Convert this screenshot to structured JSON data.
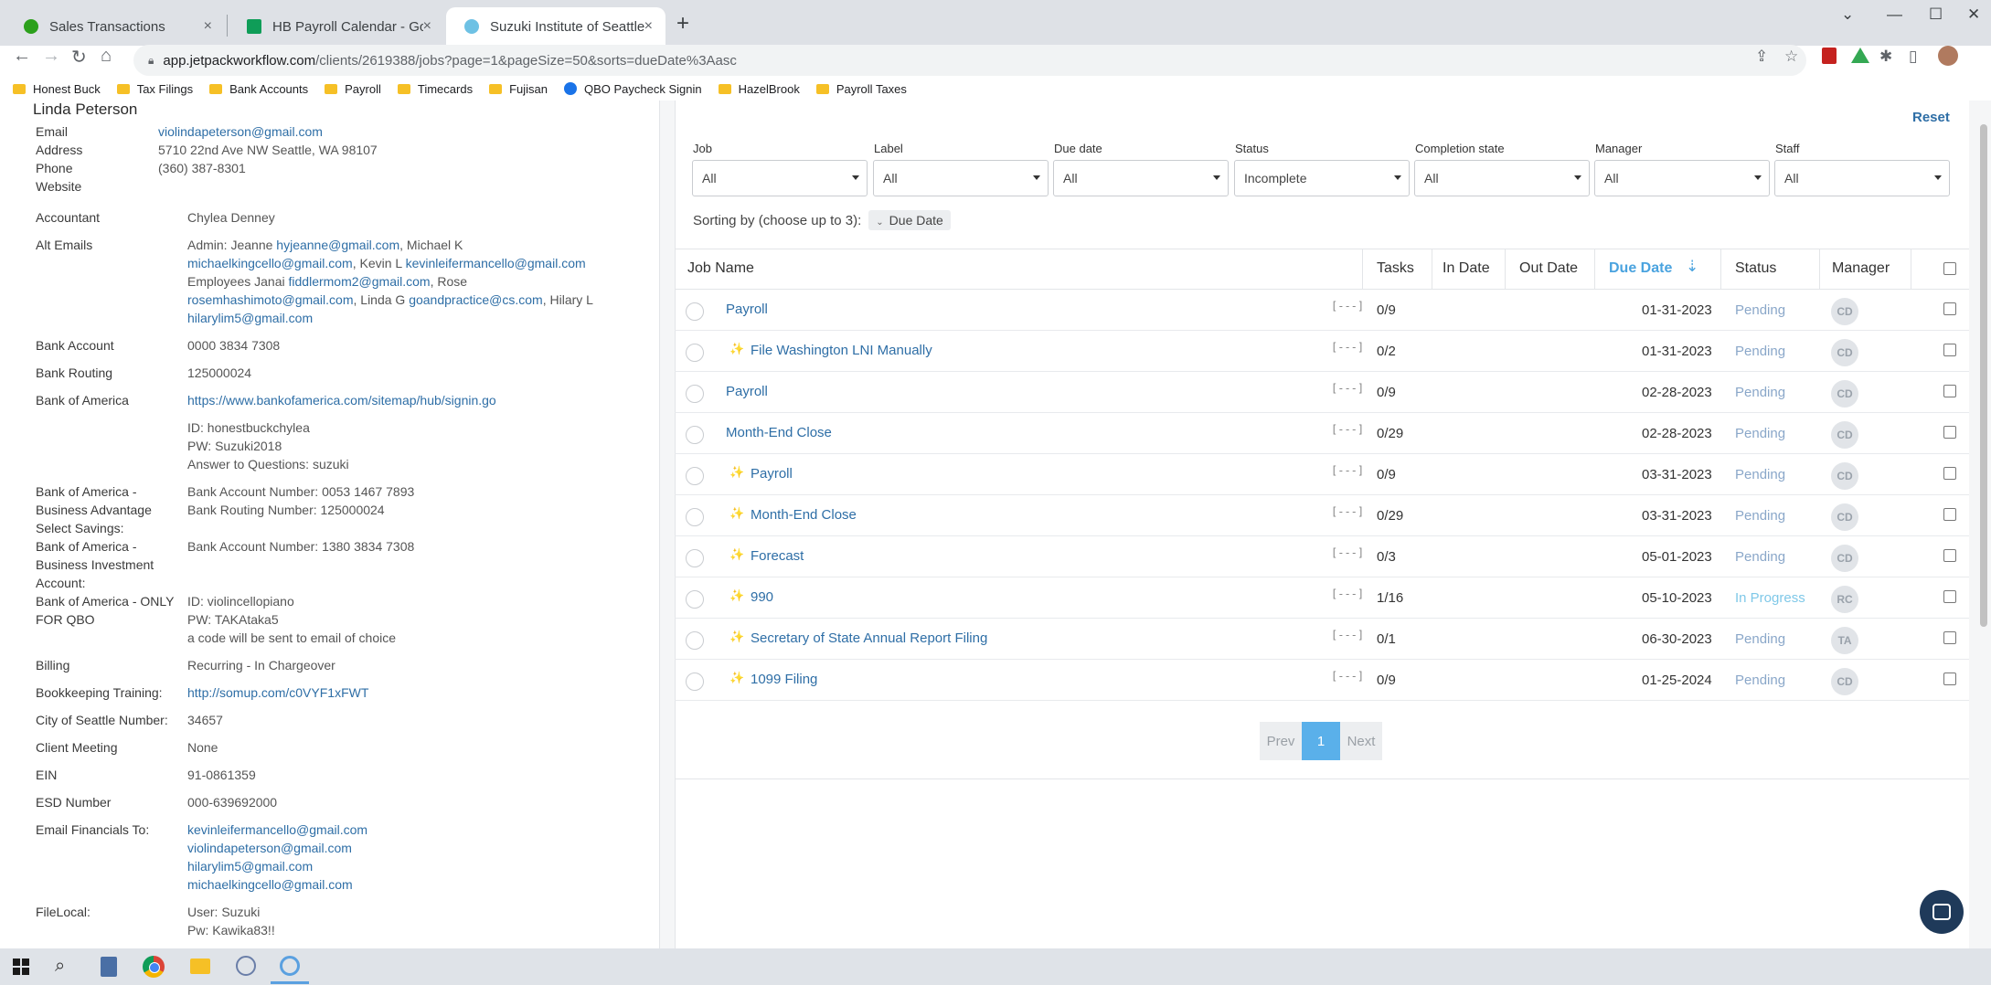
{
  "browser": {
    "tabs": [
      {
        "title": "Sales Transactions",
        "icon_color": "#2ca01c"
      },
      {
        "title": "HB Payroll Calendar - Google She",
        "icon_color": "#0f9d58"
      },
      {
        "title": "Suzuki Institute of Seattle - Jetpa",
        "icon_color": "#6ec1e4"
      }
    ],
    "new_tab": "+",
    "close_glyph": "×",
    "url_host": "app.jetpackworkflow.com",
    "url_path": "/clients/2619388/jobs?page=1&pageSize=50&sorts=dueDate%3Aasc",
    "bookmarks": [
      {
        "label": "Honest Buck",
        "icon": "folder-icon"
      },
      {
        "label": "Tax Filings",
        "icon": "folder-icon"
      },
      {
        "label": "Bank Accounts",
        "icon": "folder-icon"
      },
      {
        "label": "Payroll",
        "icon": "folder-icon"
      },
      {
        "label": "Timecards",
        "icon": "folder-icon"
      },
      {
        "label": "Fujisan",
        "icon": "folder-icon"
      },
      {
        "label": "QBO Paycheck Signin",
        "icon": "globe-icon"
      },
      {
        "label": "HazelBrook",
        "icon": "folder-icon"
      },
      {
        "label": "Payroll Taxes",
        "icon": "folder-icon"
      }
    ]
  },
  "client": {
    "name": "Linda Peterson",
    "contact": [
      {
        "label": "Email",
        "value": "violindapeterson@gmail.com",
        "link": true
      },
      {
        "label": "Address",
        "value": "5710 22nd Ave NW Seattle, WA 98107",
        "link": false
      },
      {
        "label": "Phone",
        "value": "(360) 387-8301",
        "link": false
      },
      {
        "label": "Website",
        "value": "",
        "link": false
      }
    ],
    "fields": {
      "accountant": {
        "label": "Accountant",
        "value": "Chylea Denney"
      },
      "alt_emails": {
        "label": "Alt Emails",
        "line1_a": "Admin: Jeanne ",
        "line1_b": "hyjeanne@gmail.com",
        "line1_c": ", Michael K",
        "line2_a": "michaelkingcello@gmail.com",
        "line2_b": ", Kevin L ",
        "line2_c": "kevinleifermancello@gmail.com",
        "line3_a": "Employees Janai ",
        "line3_b": "fiddlermom2@gmail.com",
        "line3_c": ", Rose",
        "line4_a": "rosemhashimoto@gmail.com",
        "line4_b": ", Linda G ",
        "line4_c": "goandpractice@cs.com",
        "line4_d": ", Hilary L",
        "line5_a": "hilarylim5@gmail.com"
      },
      "bank_account": {
        "label": "Bank Account",
        "value": "0000 3834 7308"
      },
      "bank_routing": {
        "label": "Bank Routing",
        "value": "125000024"
      },
      "boa": {
        "label": "Bank of America",
        "link": "https://www.bankofamerica.com/sitemap/hub/signin.go",
        "id": "ID: honestbuckchylea",
        "pw": "PW: Suzuki2018",
        "answer": "Answer to Questions: suzuki"
      },
      "boa_savings": {
        "label_1": "Bank of America -",
        "label_2": "Business Advantage",
        "label_3": "Select Savings:",
        "value_1": "Bank Account Number: 0053 1467 7893",
        "value_2": "Bank Routing Number: 125000024"
      },
      "boa_investment": {
        "label_1": "Bank of America -",
        "label_2": "Business Investment",
        "label_3": "Account:",
        "value_1": "Bank Account Number: 1380 3834 7308"
      },
      "boa_qbo": {
        "label_1": "Bank of America - ONLY",
        "label_2": "FOR QBO",
        "value_1": "ID: violincellopiano",
        "value_2": "PW: TAKAtaka5",
        "value_3": "a code will be sent to email of choice"
      },
      "billing": {
        "label": "Billing",
        "value": "Recurring - In Chargeover"
      },
      "bookkeeping": {
        "label": "Bookkeeping Training:",
        "value": "http://somup.com/c0VYF1xFWT"
      },
      "city_seattle": {
        "label": "City of Seattle Number:",
        "value": "34657"
      },
      "client_meeting": {
        "label": "Client Meeting",
        "value": "None"
      },
      "ein": {
        "label": "EIN",
        "value": "91-0861359"
      },
      "esd": {
        "label": "ESD Number",
        "value": "000-639692000"
      },
      "email_financials": {
        "label": "Email Financials To:",
        "emails": [
          "kevinleifermancello@gmail.com",
          "violindapeterson@gmail.com",
          "hilarylim5@gmail.com",
          "michaelkingcello@gmail.com"
        ]
      },
      "filelocal": {
        "label": "FileLocal:",
        "user": "User: Suzuki",
        "pw": "Pw: Kawika83!!"
      }
    }
  },
  "filters": {
    "reset": "Reset",
    "items": [
      {
        "label": "Job",
        "value": "All"
      },
      {
        "label": "Label",
        "value": "All"
      },
      {
        "label": "Due date",
        "value": "All"
      },
      {
        "label": "Status",
        "value": "Incomplete"
      },
      {
        "label": "Completion state",
        "value": "All"
      },
      {
        "label": "Manager",
        "value": "All"
      },
      {
        "label": "Staff",
        "value": "All"
      }
    ],
    "sorting_label": "Sorting by (choose up to 3):",
    "sort_chip": "Due Date"
  },
  "table": {
    "headers": {
      "job_name": "Job Name",
      "tasks": "Tasks",
      "in_date": "In Date",
      "out_date": "Out Date",
      "due_date": "Due Date",
      "status": "Status",
      "manager": "Manager"
    },
    "rows": [
      {
        "name": "Payroll",
        "sparkle": false,
        "notes": "[---]",
        "tasks": "0/9",
        "due": "01-31-2023",
        "status": "Pending",
        "manager": "CD"
      },
      {
        "name": "File Washington LNI Manually",
        "sparkle": true,
        "notes": "[---]",
        "tasks": "0/2",
        "due": "01-31-2023",
        "status": "Pending",
        "manager": "CD"
      },
      {
        "name": "Payroll",
        "sparkle": false,
        "notes": "[---]",
        "tasks": "0/9",
        "due": "02-28-2023",
        "status": "Pending",
        "manager": "CD"
      },
      {
        "name": "Month-End Close",
        "sparkle": false,
        "notes": "[---]",
        "tasks": "0/29",
        "due": "02-28-2023",
        "status": "Pending",
        "manager": "CD"
      },
      {
        "name": "Payroll",
        "sparkle": true,
        "notes": "[---]",
        "tasks": "0/9",
        "due": "03-31-2023",
        "status": "Pending",
        "manager": "CD"
      },
      {
        "name": "Month-End Close",
        "sparkle": true,
        "notes": "[---]",
        "tasks": "0/29",
        "due": "03-31-2023",
        "status": "Pending",
        "manager": "CD"
      },
      {
        "name": "Forecast",
        "sparkle": true,
        "notes": "[---]",
        "tasks": "0/3",
        "due": "05-01-2023",
        "status": "Pending",
        "manager": "CD"
      },
      {
        "name": "990",
        "sparkle": true,
        "notes": "[---]",
        "tasks": "1/16",
        "due": "05-10-2023",
        "status": "In Progress",
        "manager": "RC"
      },
      {
        "name": "Secretary of State Annual Report Filing",
        "sparkle": true,
        "notes": "[---]",
        "tasks": "0/1",
        "due": "06-30-2023",
        "status": "Pending",
        "manager": "TA"
      },
      {
        "name": "1099 Filing",
        "sparkle": true,
        "notes": "[---]",
        "tasks": "0/9",
        "due": "01-25-2024",
        "status": "Pending",
        "manager": "CD"
      }
    ]
  },
  "pagination": {
    "prev": "Prev",
    "current": "1",
    "next": "Next"
  },
  "colors": {
    "accent": "#4aa3df",
    "link": "#2e6ea6",
    "pending": "#8aa7c9",
    "in_progress": "#7fc8e8"
  }
}
